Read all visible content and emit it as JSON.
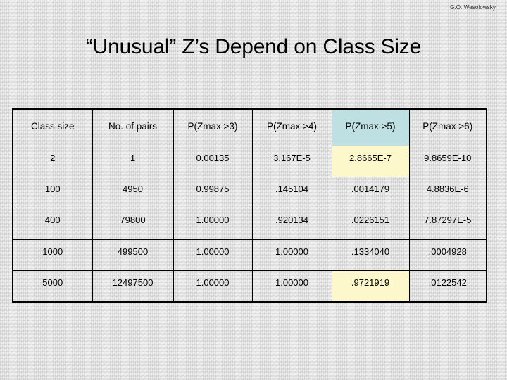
{
  "slide": {
    "author_credit": "G.O. Wesolowsky",
    "title": "“Unusual” Z’s Depend on Class Size"
  },
  "colors": {
    "header_highlight": "#bfe0e3",
    "cell_highlight": "#fdf8cc",
    "background": "#f3f3f3",
    "text": "#000000",
    "border": "#000000"
  },
  "chart_data": {
    "type": "table",
    "title": "“Unusual” Z’s Depend on Class Size",
    "columns": [
      "Class size",
      "No. of pairs",
      "P(Zmax >3)",
      "P(Zmax >4)",
      "P(Zmax >5)",
      "P(Zmax >6)"
    ],
    "highlighted_column": "P(Zmax >5)",
    "highlighted_cells": [
      {
        "row": 0,
        "column": "P(Zmax >5)"
      },
      {
        "row": 4,
        "column": "P(Zmax >5)"
      }
    ],
    "rows": [
      [
        "2",
        "1",
        "0.00135",
        "3.167E-5",
        "2.8665E-7",
        "9.8659E-10"
      ],
      [
        "100",
        "4950",
        "0.99875",
        ".145104",
        ".0014179",
        "4.8836E-6"
      ],
      [
        "400",
        "79800",
        "1.00000",
        ".920134",
        ".0226151",
        "7.87297E-5"
      ],
      [
        "1000",
        "499500",
        "1.00000",
        "1.00000",
        ".1334040",
        ".0004928"
      ],
      [
        "5000",
        "12497500",
        "1.00000",
        "1.00000",
        ".9721919",
        ".0122542"
      ]
    ],
    "class_size": [
      2,
      100,
      400,
      1000,
      5000
    ],
    "no_of_pairs": [
      1,
      4950,
      79800,
      499500,
      12497500
    ],
    "series": [
      {
        "name": "P(Zmax >3)",
        "values": [
          0.00135,
          0.99875,
          1.0,
          1.0,
          1.0
        ]
      },
      {
        "name": "P(Zmax >4)",
        "values": [
          3.167e-05,
          0.145104,
          0.920134,
          1.0,
          1.0
        ]
      },
      {
        "name": "P(Zmax >5)",
        "values": [
          2.8665e-07,
          0.0014179,
          0.0226151,
          0.133404,
          0.9721919
        ]
      },
      {
        "name": "P(Zmax >6)",
        "values": [
          9.8659e-10,
          4.8836e-06,
          7.87297e-05,
          0.0004928,
          0.0122542
        ]
      }
    ]
  }
}
